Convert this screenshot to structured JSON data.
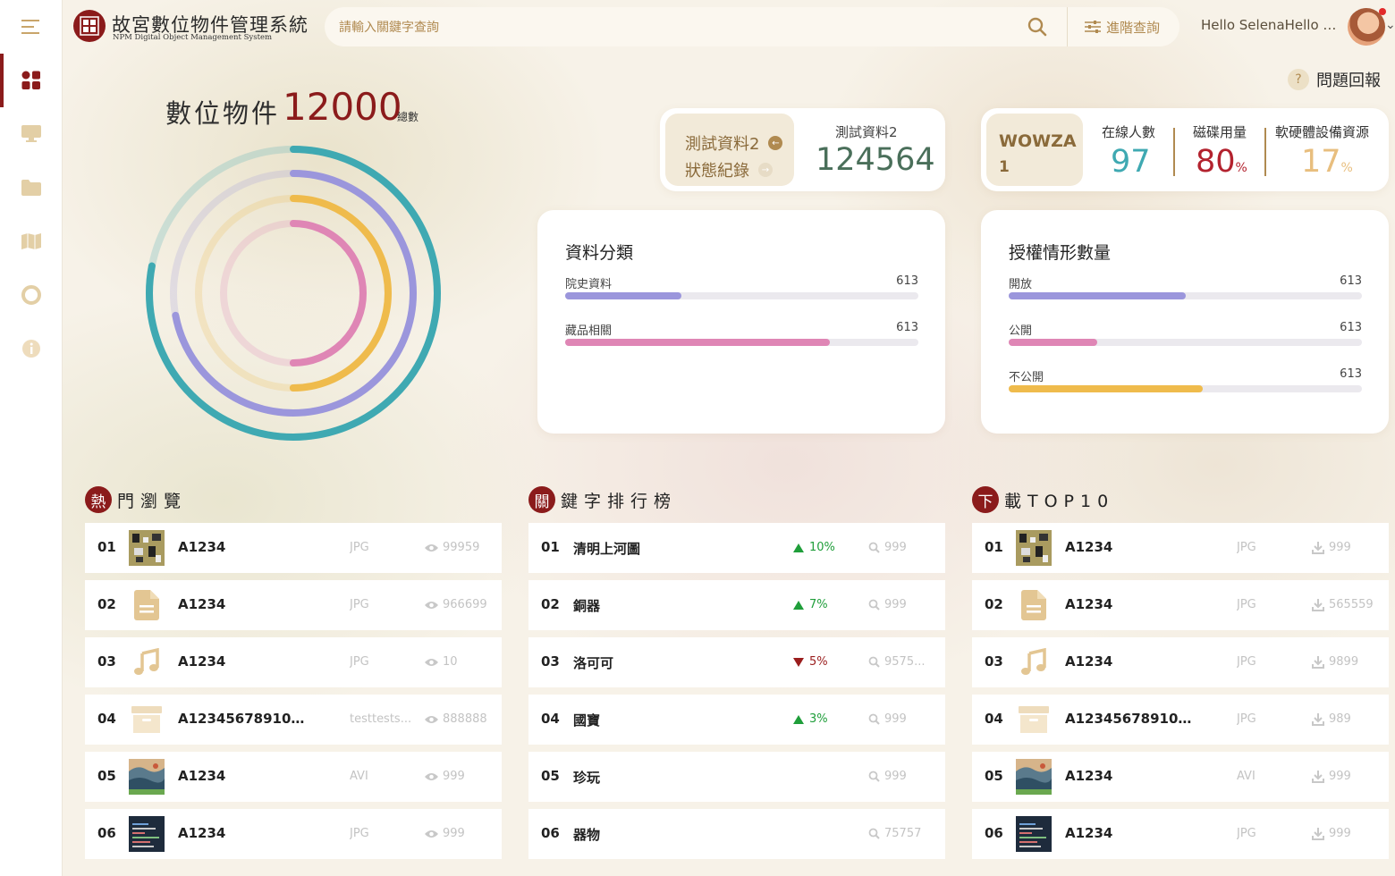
{
  "header": {
    "brand_title": "故宮數位物件管理系統",
    "brand_subtitle": "NPM Digital Object Management System",
    "search_placeholder": "請輸入關鍵字查詢",
    "advanced_label": "進階查詢",
    "user_greeting": "Hello SelenaHello S...",
    "report_label": "問題回報"
  },
  "sidebar": {
    "items": [
      {
        "icon": "menu-icon"
      },
      {
        "icon": "dashboard-icon",
        "active": true
      },
      {
        "icon": "monitor-icon"
      },
      {
        "icon": "folder-icon"
      },
      {
        "icon": "map-icon"
      },
      {
        "icon": "support-icon"
      },
      {
        "icon": "info-icon"
      }
    ]
  },
  "overview": {
    "label": "數位物件",
    "total": "12000",
    "unit": "總數",
    "ring_colors": [
      "#3fa9b2",
      "#9b96dc",
      "#efbb4c",
      "#df86b5"
    ],
    "ring_levels": [
      0.78,
      0.72,
      0.5,
      0.5
    ]
  },
  "test_card": {
    "chip_line1": "測試資料2",
    "chip_line2": "狀態紀錄",
    "label": "測試資料2",
    "value": "124564"
  },
  "server_card": {
    "name": "WOWZA",
    "index": "1",
    "online_label": "在線人數",
    "online_value": "97",
    "disk_label": "磁碟用量",
    "disk_value": "80",
    "disk_unit": "%",
    "hw_label": "軟硬體設備資源",
    "hw_value": "17",
    "hw_unit": "%",
    "colors": {
      "online": "#3fa9b2",
      "disk": "#b3222e",
      "hw": "#e8be7e"
    }
  },
  "category_card": {
    "title": "資料分類",
    "rows": [
      {
        "label": "院史資料",
        "value": "613",
        "level": 0.33,
        "color": "#9b96dc"
      },
      {
        "label": "藏品相關",
        "value": "613",
        "level": 0.75,
        "color": "#df86b5"
      }
    ]
  },
  "license_card": {
    "title": "授權情形數量",
    "rows": [
      {
        "label": "開放",
        "value": "613",
        "level": 0.5,
        "color": "#9b96dc"
      },
      {
        "label": "公開",
        "value": "613",
        "level": 0.25,
        "color": "#df86b5"
      },
      {
        "label": "不公開",
        "value": "613",
        "level": 0.55,
        "color": "#efbb4c"
      }
    ]
  },
  "hot_views": {
    "badge": "熱",
    "title": "門瀏覽",
    "rows": [
      {
        "no": "01",
        "thumb": "image",
        "name": "A1234",
        "ext": "JPG",
        "count": "99959"
      },
      {
        "no": "02",
        "thumb": "document",
        "name": "A1234",
        "ext": "JPG",
        "count": "966699"
      },
      {
        "no": "03",
        "thumb": "audio",
        "name": "A1234",
        "ext": "JPG",
        "count": "10"
      },
      {
        "no": "04",
        "thumb": "archive",
        "name": "A123456789101...",
        "ext": "testtests...",
        "count": "888888"
      },
      {
        "no": "05",
        "thumb": "video",
        "name": "A1234",
        "ext": "AVI",
        "count": "999"
      },
      {
        "no": "06",
        "thumb": "code",
        "name": "A1234",
        "ext": "JPG",
        "count": "999"
      }
    ]
  },
  "keyword_rank": {
    "badge": "關",
    "title": "鍵字排行榜",
    "rows": [
      {
        "no": "01",
        "keyword": "清明上河圖",
        "trend": "up",
        "pct": "10%",
        "count": "999"
      },
      {
        "no": "02",
        "keyword": "銅器",
        "trend": "up",
        "pct": "7%",
        "count": "999"
      },
      {
        "no": "03",
        "keyword": "洛可可",
        "trend": "down",
        "pct": "5%",
        "count": "9575..."
      },
      {
        "no": "04",
        "keyword": "國寶",
        "trend": "up",
        "pct": "3%",
        "count": "999"
      },
      {
        "no": "05",
        "keyword": "珍玩",
        "trend": "none",
        "pct": "",
        "count": "999"
      },
      {
        "no": "06",
        "keyword": "器物",
        "trend": "none",
        "pct": "",
        "count": "75757"
      }
    ]
  },
  "downloads": {
    "badge": "下",
    "title": "載TOP10",
    "rows": [
      {
        "no": "01",
        "thumb": "image",
        "name": "A1234",
        "ext": "JPG",
        "count": "999"
      },
      {
        "no": "02",
        "thumb": "document",
        "name": "A1234",
        "ext": "JPG",
        "count": "565559"
      },
      {
        "no": "03",
        "thumb": "audio",
        "name": "A1234",
        "ext": "JPG",
        "count": "9899"
      },
      {
        "no": "04",
        "thumb": "archive",
        "name": "A123456789101...",
        "ext": "JPG",
        "count": "989"
      },
      {
        "no": "05",
        "thumb": "video",
        "name": "A1234",
        "ext": "AVI",
        "count": "999"
      },
      {
        "no": "06",
        "thumb": "code",
        "name": "A1234",
        "ext": "JPG",
        "count": "999"
      }
    ]
  }
}
